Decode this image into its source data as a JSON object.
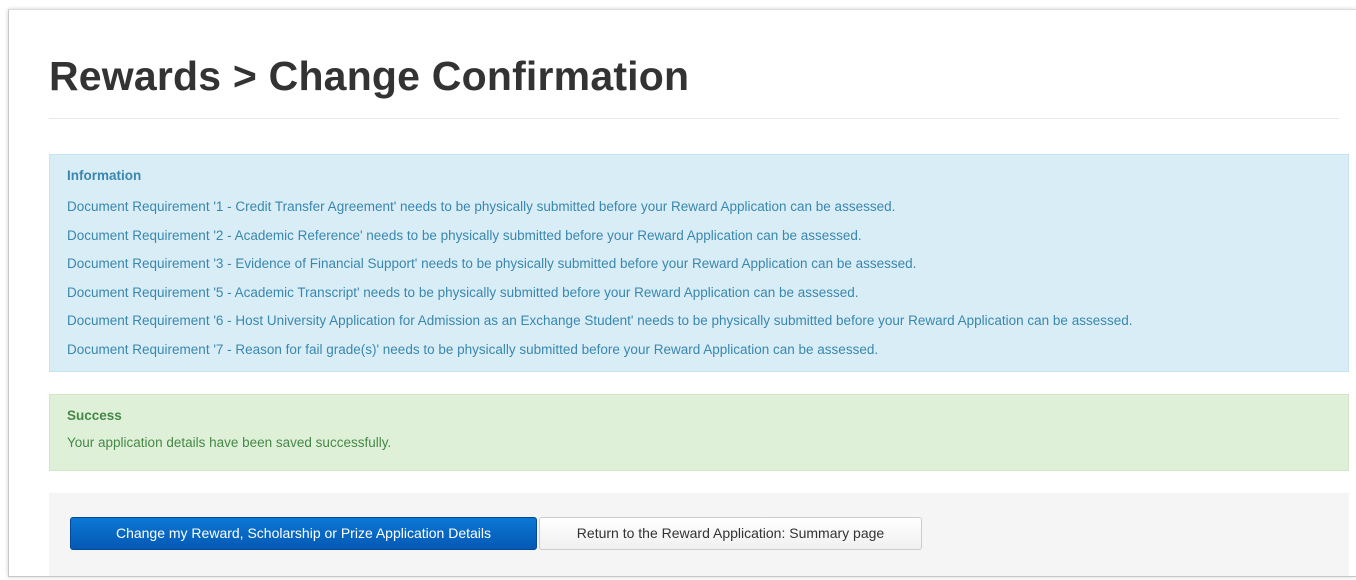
{
  "page": {
    "title": "Rewards > Change Confirmation"
  },
  "info_alert": {
    "heading": "Information",
    "messages": [
      "Document Requirement '1 - Credit Transfer Agreement' needs to be physically submitted before your Reward Application can be assessed.",
      "Document Requirement '2 - Academic Reference' needs to be physically submitted before your Reward Application can be assessed.",
      "Document Requirement '3 - Evidence of Financial Support' needs to be physically submitted before your Reward Application can be assessed.",
      "Document Requirement '5 - Academic Transcript' needs to be physically submitted before your Reward Application can be assessed.",
      "Document Requirement '6 - Host University Application for Admission as an Exchange Student' needs to be physically submitted before your Reward Application can be assessed.",
      "Document Requirement '7 - Reason for fail grade(s)' needs to be physically submitted before your Reward Application can be assessed."
    ]
  },
  "success_alert": {
    "heading": "Success",
    "message": "Your application details have been saved successfully."
  },
  "actions": {
    "change_label": "Change my Reward, Scholarship or Prize Application Details",
    "return_label": "Return to the Reward Application: Summary page"
  },
  "colors": {
    "info_background": "#d9edf7",
    "info_text": "#3a87ad",
    "success_background": "#dff0d8",
    "success_text": "#468847",
    "primary_button": "#0559b5"
  }
}
